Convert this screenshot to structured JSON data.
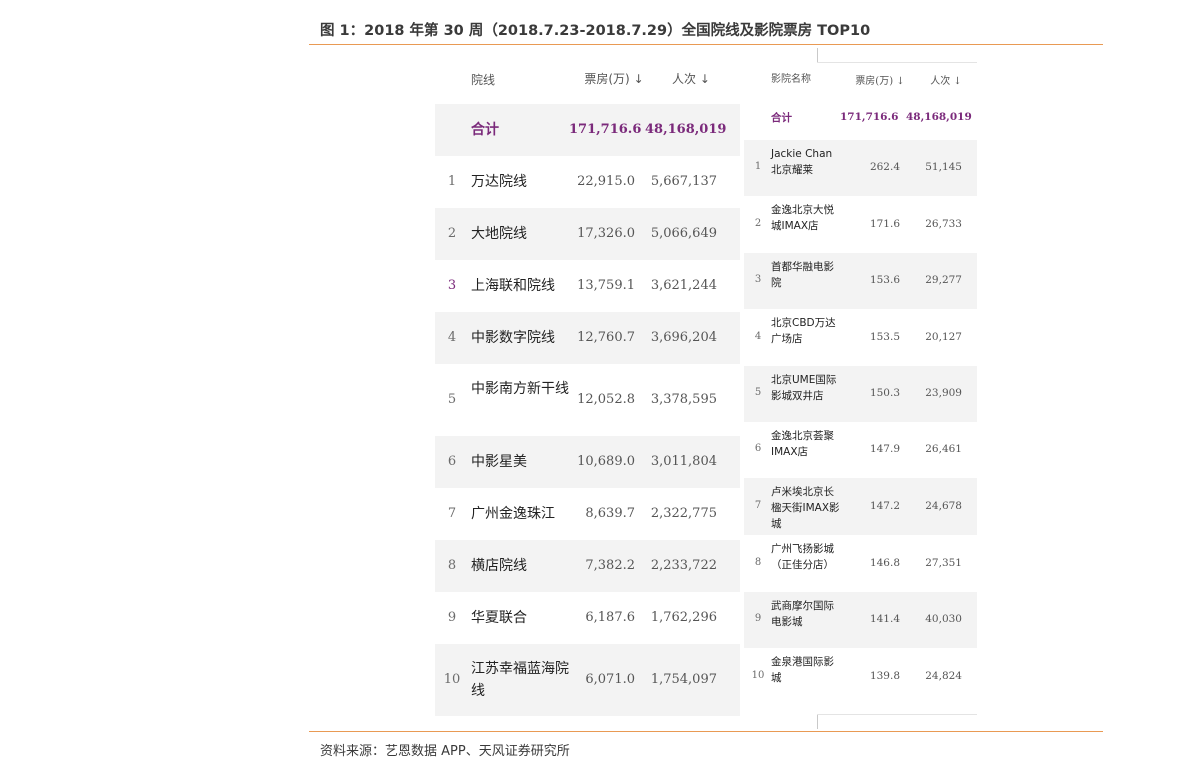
{
  "figure": {
    "title": "图 1：2018 年第 30 周（2018.7.23-2018.7.29）全国院线及影院票房 TOP10",
    "source": "资料来源：艺恩数据 APP、天风证券研究所"
  },
  "colors": {
    "accent_rule": "#e99a54",
    "highlight": "#7b2a7b",
    "row_shade": "#f3f3f3"
  },
  "left_table": {
    "headers": {
      "name": "院线",
      "box_office": "票房(万)",
      "admissions": "人次"
    },
    "sort_icons": {
      "box_office": "down-arrow-active",
      "admissions": "down-arrow-inactive"
    },
    "total": {
      "label": "合计",
      "box_office": "171,716.6",
      "admissions": "48,168,019"
    },
    "rows": [
      {
        "rank": "1",
        "name": "万达院线",
        "box_office": "22,915.0",
        "admissions": "5,667,137"
      },
      {
        "rank": "2",
        "name": "大地院线",
        "box_office": "17,326.0",
        "admissions": "5,066,649"
      },
      {
        "rank": "3",
        "name": "上海联和院线",
        "box_office": "13,759.1",
        "admissions": "3,621,244"
      },
      {
        "rank": "4",
        "name": "中影数字院线",
        "box_office": "12,760.7",
        "admissions": "3,696,204"
      },
      {
        "rank": "5",
        "name": "中影南方新干线",
        "box_office": "12,052.8",
        "admissions": "3,378,595"
      },
      {
        "rank": "6",
        "name": "中影星美",
        "box_office": "10,689.0",
        "admissions": "3,011,804"
      },
      {
        "rank": "7",
        "name": "广州金逸珠江",
        "box_office": "8,639.7",
        "admissions": "2,322,775"
      },
      {
        "rank": "8",
        "name": "横店院线",
        "box_office": "7,382.2",
        "admissions": "2,233,722"
      },
      {
        "rank": "9",
        "name": "华夏联合",
        "box_office": "6,187.6",
        "admissions": "1,762,296"
      },
      {
        "rank": "10",
        "name": "江苏幸福蓝海院线",
        "box_office": "6,071.0",
        "admissions": "1,754,097"
      }
    ]
  },
  "right_table": {
    "headers": {
      "name": "影院名称",
      "box_office": "票房(万)",
      "admissions": "人次"
    },
    "sort_icons": {
      "box_office": "down-arrow-active",
      "admissions": "down-arrow-inactive"
    },
    "total": {
      "label": "合计",
      "box_office": "171,716.6",
      "admissions": "48,168,019"
    },
    "rows": [
      {
        "rank": "1",
        "name": "Jackie Chan 北京耀莱",
        "box_office": "262.4",
        "admissions": "51,145"
      },
      {
        "rank": "2",
        "name": "金逸北京大悦城IMAX店",
        "box_office": "171.6",
        "admissions": "26,733"
      },
      {
        "rank": "3",
        "name": "首都华融电影院",
        "box_office": "153.6",
        "admissions": "29,277"
      },
      {
        "rank": "4",
        "name": "北京CBD万达广场店",
        "box_office": "153.5",
        "admissions": "20,127"
      },
      {
        "rank": "5",
        "name": "北京UME国际影城双井店",
        "box_office": "150.3",
        "admissions": "23,909"
      },
      {
        "rank": "6",
        "name": "金逸北京荟聚IMAX店",
        "box_office": "147.9",
        "admissions": "26,461"
      },
      {
        "rank": "7",
        "name": "卢米埃北京长楹天街IMAX影城",
        "box_office": "147.2",
        "admissions": "24,678"
      },
      {
        "rank": "8",
        "name": "广州飞扬影城（正佳分店）",
        "box_office": "146.8",
        "admissions": "27,351"
      },
      {
        "rank": "9",
        "name": "武商摩尔国际电影城",
        "box_office": "141.4",
        "admissions": "40,030"
      },
      {
        "rank": "10",
        "name": "金泉港国际影城",
        "box_office": "139.8",
        "admissions": "24,824"
      }
    ]
  }
}
